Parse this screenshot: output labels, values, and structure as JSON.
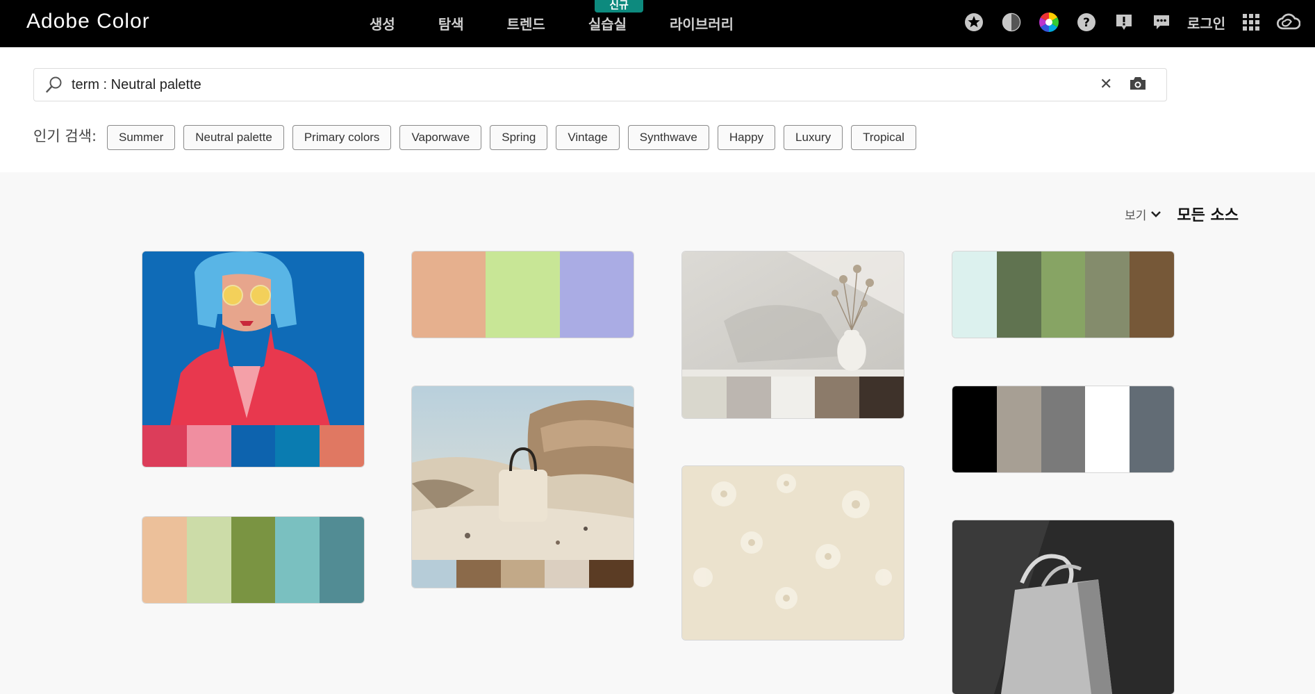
{
  "app": {
    "brand": "Adobe Color"
  },
  "nav": {
    "items": [
      "생성",
      "탐색",
      "트렌드",
      "실습실",
      "라이브러리"
    ],
    "new_badge": "신규"
  },
  "header_icons": [
    "star-icon",
    "contrast-icon",
    "color-wheel-icon",
    "help-icon",
    "feedback-icon",
    "chat-icon"
  ],
  "login_label": "로그인",
  "search": {
    "value": "term : Neutral palette",
    "placeholder": ""
  },
  "popular": {
    "label": "인기 검색:",
    "tags": [
      "Summer",
      "Neutral palette",
      "Primary colors",
      "Vaporwave",
      "Spring",
      "Vintage",
      "Synthwave",
      "Happy",
      "Luxury",
      "Tropical"
    ]
  },
  "sort": {
    "view_label": "보기",
    "source_label": "모든 소스"
  },
  "colors": {
    "topbar": "#000000",
    "badge": "#0d8a7e",
    "page_bg": "#f8f8f8"
  },
  "results": [
    {
      "type": "image",
      "image": "woman with blue bob hair and yellow glasses in red jacket",
      "colors": [
        "#dc3d5a",
        "#f08ea0",
        "#0d63ae",
        "#0a7cb1",
        "#e07862"
      ]
    },
    {
      "type": "palette",
      "colors": [
        "#e6b08e",
        "#c8e696",
        "#aaace4"
      ]
    },
    {
      "type": "image",
      "image": "dried grass in white vase on neutral background",
      "colors": [
        "#d9d7cd",
        "#bcb6b0",
        "#f0efeb",
        "#8c7b6a",
        "#3e322a"
      ]
    },
    {
      "type": "palette",
      "colors": [
        "#dcf1ee",
        "#607350",
        "#87a464",
        "#848c6c",
        "#765838"
      ]
    },
    {
      "type": "image",
      "image": "cream handbag in sand dunes",
      "colors": [
        "#b6ccd8",
        "#8b6a4a",
        "#c2a988",
        "#dbcfc0",
        "#5b3c24"
      ]
    },
    {
      "type": "palette",
      "colors": [
        "#000000",
        "#a79f94",
        "#7a7a7a",
        "#ffffff",
        "#626c75"
      ]
    },
    {
      "type": "palette",
      "colors": [
        "#ecc09a",
        "#ccdca8",
        "#7a9442",
        "#7ac0c0",
        "#528c94"
      ]
    },
    {
      "type": "image",
      "image": "beige floral pattern",
      "colors": []
    },
    {
      "type": "image",
      "image": "black and white bag photo",
      "colors": []
    }
  ]
}
